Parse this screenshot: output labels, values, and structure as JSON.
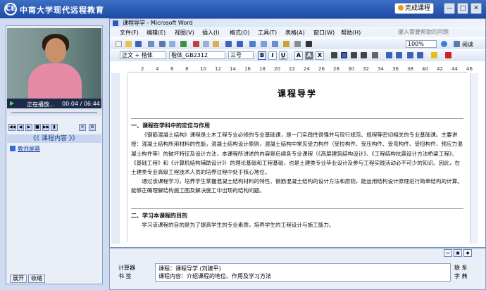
{
  "app": {
    "logo_glyph": "CE",
    "title": "中南大学现代远程教育"
  },
  "window": {
    "finish_label": "完成课程",
    "min_glyph": "—",
    "max_glyph": "□",
    "close_glyph": "✕"
  },
  "player": {
    "status": "正在播放...",
    "time": "00:04 / 06:44",
    "play_glyph": "▶"
  },
  "controls": [
    "◀◀",
    "◀",
    "▶",
    "■",
    "▶▶",
    "▮",
    "✕",
    "⚙"
  ],
  "course": {
    "header": "《《 课程内容 》》",
    "item": "教师屏幕"
  },
  "left_buttons": {
    "expand": "展开",
    "collapse": "收缩"
  },
  "word": {
    "title": "课程导学 - Microsoft Word",
    "menus": [
      "文件(F)",
      "编辑(E)",
      "视图(V)",
      "插入(I)",
      "格式(O)",
      "工具(T)",
      "表格(A)",
      "窗口(W)",
      "帮助(H)"
    ],
    "help_placeholder": "键入需要帮助的问题",
    "zoom": "100%",
    "read_label": "阅读",
    "style": "正文 + 楷体",
    "font": "楷体_GB2312",
    "size": "三号",
    "ruler": [
      "2",
      "4",
      "6",
      "8",
      "10",
      "12",
      "14",
      "16",
      "18",
      "20",
      "22",
      "24",
      "26",
      "28",
      "30",
      "32",
      "34",
      "36",
      "38",
      "40",
      "42",
      "44",
      "46"
    ]
  },
  "doc": {
    "title": "课程导学",
    "h1": "一、课程在学科中的定位与作用",
    "p1": "《钢筋混凝土结构》课程是土木工程专业必修的专业基础课，是一门实践性很强并与现行规范、规程等密切相关的专业基础课。主要讲授：混凝土结构所用材料的性能，混凝土结构设计原则，混凝土结构中常见受力构件（受拉构件、受压构件、受弯构件、受扭构件、预应力混凝土构件等）的破坏特征及设计方法，本课程所讲述的内容是后续各专业课程（《高层建筑结构设计》、《工程结构抗震设计方法桥梁工程》、《基础工程》和《计算机结构辅助设计》）的理论基础和工程基础，也是土建类专业毕业设计及参与工程实践活动必不可少的知识。因此，在土建类专业高级工程技术人员的培养过程中处于核心地位。",
    "p2": "通过该课程学习，培养学生掌握混凝土结构材料的特性、钢筋混凝土结构的设计方法和原则，能运用结构设计原理进行简单结构的计算。能够正确理解结构施工图及解决施工中出现的结构问题。",
    "h2": "二、学习本课程的目的",
    "p3": "学习该课程的目的是为了提高学生的专业素质，培养学生的工程设计与施工能力。"
  },
  "bottom": {
    "calc": "计算器",
    "bookmark": "书 签",
    "note1": "课程：课程导学 (刘建平)",
    "note2": "课程内容：介绍课程的地位、作用及学习方法",
    "contact": "联 系",
    "dict": "字 典"
  }
}
